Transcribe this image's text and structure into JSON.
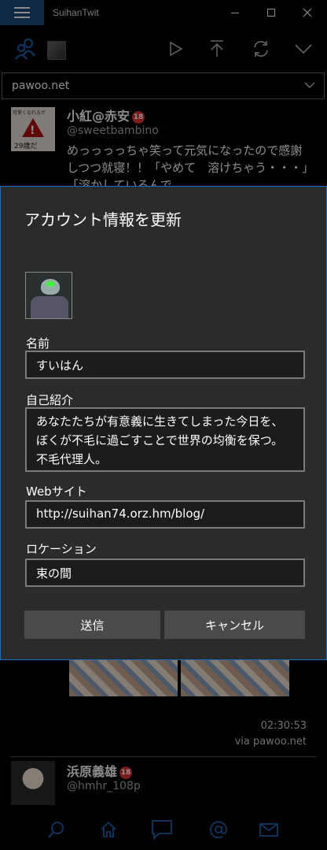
{
  "window": {
    "title": "SuihanTwit"
  },
  "account": {
    "selected": "pawoo.net"
  },
  "timeline": {
    "tweet1": {
      "name": "小紅@赤安",
      "badge": "18",
      "handle": "@sweetbambino",
      "body": "めっっっっちゃ笑って元気になったので感謝しつつ就寝！！「やめて　溶けちゃう・・・」「溶かしているんで",
      "avatar_top_text": "可愛くなれるが",
      "avatar_bottom_text": "29歳だ",
      "time": "02:30:53",
      "via": "via pawoo.net"
    },
    "tweet2": {
      "name": "浜原義雄",
      "badge": "18",
      "handle": "@hmhr_108p"
    }
  },
  "dialog": {
    "title": "アカウント情報を更新",
    "name_label": "名前",
    "name_value": "すいはん",
    "bio_label": "自己紹介",
    "bio_value": "あなたたちが有意義に生きてしまった今日を、ぼくが不毛に過ごすことで世界の均衡を保つ。不毛代理人。",
    "web_label": "Webサイト",
    "web_value": "http://suihan74.orz.hm/blog/",
    "location_label": "ロケーション",
    "location_value": "束の間",
    "submit_label": "送信",
    "cancel_label": "キャンセル"
  },
  "colors": {
    "accent": "#1e6fb8",
    "icon_blue": "#1c5aa0"
  }
}
